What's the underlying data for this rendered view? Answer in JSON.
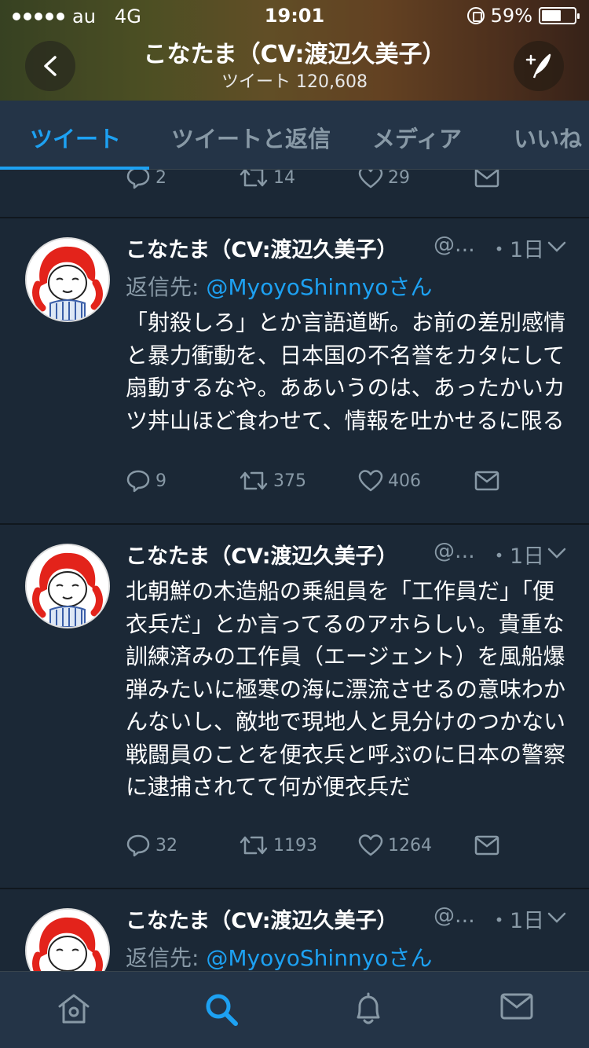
{
  "statusbar": {
    "carrier": "au",
    "network": "4G",
    "time": "19:01",
    "battery": "59%",
    "battery_level": 0.59
  },
  "header": {
    "title": "こなたま（CV:渡辺久美子）",
    "subtitle": "ツイート 120,608",
    "back_icon": "chevron-left-icon",
    "compose_icon": "compose-feather-icon"
  },
  "tabs": [
    {
      "label": "ツイート",
      "active": true
    },
    {
      "label": "ツイートと返信",
      "active": false
    },
    {
      "label": "メディア",
      "active": false
    },
    {
      "label": "いいね",
      "active": false
    }
  ],
  "prev_tweet_actions": {
    "replies": "2",
    "retweets": "14",
    "likes": "29"
  },
  "tweets": [
    {
      "name": "こなたま（CV:渡辺久美子）",
      "handle": "@...",
      "time": "・1日",
      "reply_prefix": "返信先: ",
      "reply_to": "@MyoyoShinnyoさん",
      "body": "「射殺しろ」とか言語道断。お前の差別感情と暴力衝動を、日本国の不名誉をカタにして扇動するなや。ああいうのは、あったかいカツ丼山ほど食わせて、情報を吐かせるに限る",
      "replies": "9",
      "retweets": "375",
      "likes": "406"
    },
    {
      "name": "こなたま（CV:渡辺久美子）",
      "handle": "@...",
      "time": "・1日",
      "body": "北朝鮮の木造船の乗組員を「工作員だ」「便衣兵だ」とか言ってるのアホらしい。貴重な訓練済みの工作員（エージェント）を風船爆弾みたいに極寒の海に漂流させるの意味わかんないし、敵地で現地人と見分けのつかない戦闘員のことを便衣兵と呼ぶのに日本の警察に逮捕されてて何が便衣兵だ",
      "replies": "32",
      "retweets": "1193",
      "likes": "1264"
    },
    {
      "name": "こなたま（CV:渡辺久美子）",
      "handle": "@...",
      "time": "・1日",
      "reply_prefix": "返信先: ",
      "reply_to": "@MyoyoShinnyoさん"
    }
  ],
  "bottom_nav": [
    {
      "icon": "home-icon",
      "active": false
    },
    {
      "icon": "search-icon",
      "active": true
    },
    {
      "icon": "bell-icon",
      "active": false
    },
    {
      "icon": "mail-icon",
      "active": false
    }
  ],
  "colors": {
    "background": "#1b2836",
    "accent": "#1da1f2",
    "muted": "#8899a6"
  }
}
